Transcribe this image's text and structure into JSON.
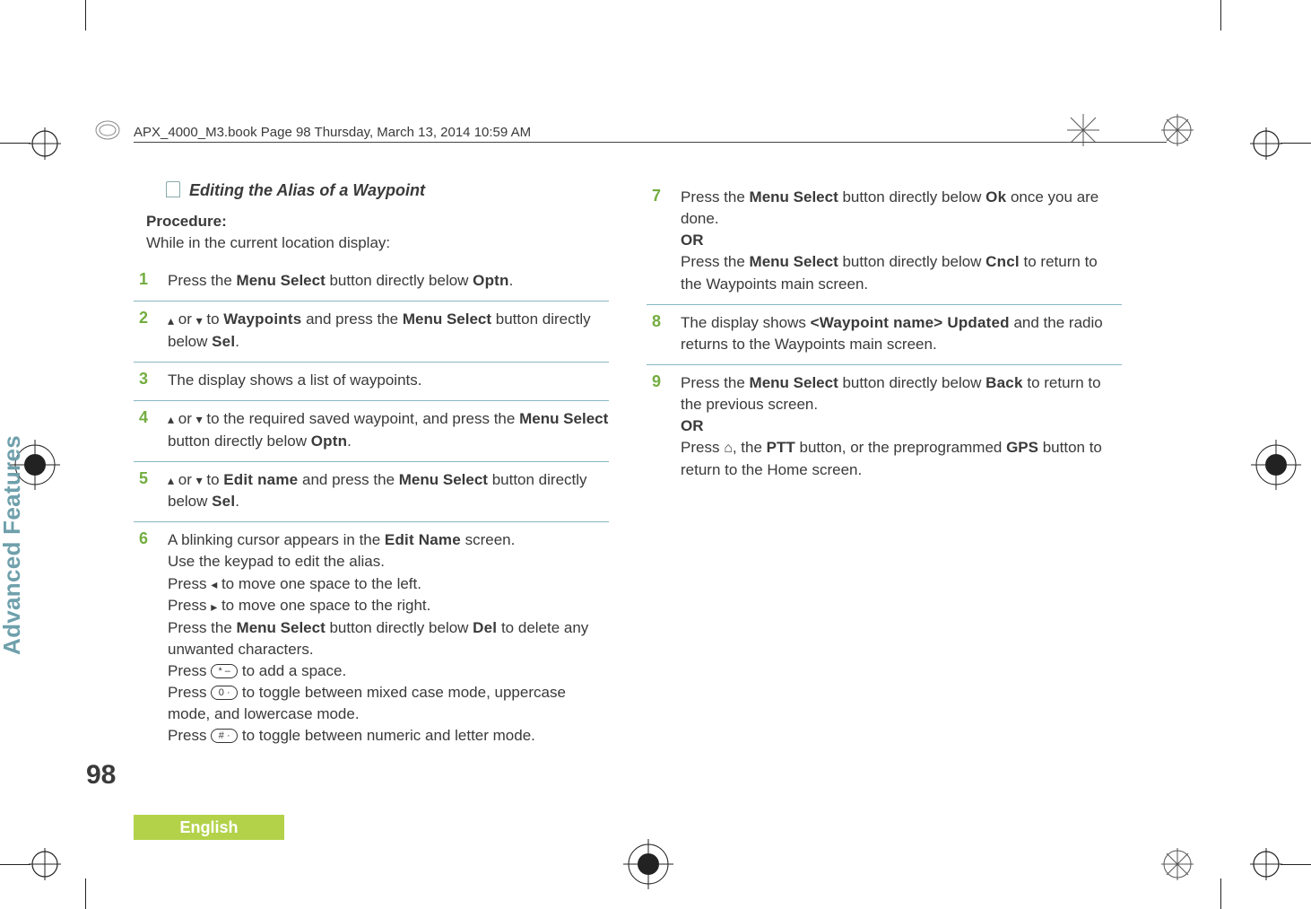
{
  "header": {
    "book_ref": "APX_4000_M3.book  Page 98  Thursday, March 13, 2014  10:59 AM"
  },
  "section": {
    "title": "Editing the Alias of a Waypoint",
    "procedure_label": "Procedure:",
    "procedure_sub": "While in the current location display:"
  },
  "steps_left": [
    {
      "n": "1",
      "html": "Press the <b>Menu Select</b> button directly below <span class='ui'>Optn</span>."
    },
    {
      "n": "2",
      "html": "<span class='arrow-up'></span> or <span class='arrow-down'></span> to <span class='ui'>Waypoints</span> and press the <b>Menu Select</b> button directly below <span class='ui'>Sel</span>."
    },
    {
      "n": "3",
      "html": "The display shows a list of waypoints."
    },
    {
      "n": "4",
      "html": "<span class='arrow-up'></span> or <span class='arrow-down'></span> to the required saved waypoint, and press the <b>Menu Select</b> button directly below <span class='ui'>Optn</span>."
    },
    {
      "n": "5",
      "html": "<span class='arrow-up'></span> or <span class='arrow-down'></span> to <span class='ui'>Edit name</span> and press the <b>Menu Select</b> button directly below <span class='ui'>Sel</span>."
    },
    {
      "n": "6",
      "html": "A blinking cursor appears in the <span class='ui'>Edit Name</span> screen.<br>Use the keypad to edit the alias.<br>Press <span class='arrow-left'></span> to move one space to the left.<br>Press <span class='arrow-right'></span> to move one space to the right.<br>Press the <b>Menu Select</b> button directly below <span class='ui'>Del</span> to delete any unwanted characters.<br>Press <span class='key'>* –</span> to add a space.<br>Press <span class='key'>0 ·</span> to toggle between mixed case mode, uppercase mode, and lowercase mode.<br>Press <span class='key'># ·</span> to toggle between numeric and letter mode."
    }
  ],
  "steps_right": [
    {
      "n": "7",
      "html": "Press the <b>Menu Select</b> button directly below <span class='ui'>Ok</span> once you are done.<br><span class='or'>OR</span><br>Press the <b>Menu Select</b> button directly below <span class='ui'>Cncl</span> to return to the Waypoints main screen."
    },
    {
      "n": "8",
      "html": "The display shows <span class='ui'>&lt;Waypoint name&gt; Updated</span> and the radio returns to the Waypoints main screen."
    },
    {
      "n": "9",
      "html": "Press the <b>Menu Select</b> button directly below <span class='ui'>Back</span> to return to the previous screen.<br><span class='or'>OR</span><br>Press <span class='home-icon'></span>, the <b>PTT</b> button, or the preprogrammed <b>GPS</b> button to return to the Home screen."
    }
  ],
  "side": {
    "vertical_label": "Advanced Features",
    "page_number": "98",
    "language": "English"
  }
}
